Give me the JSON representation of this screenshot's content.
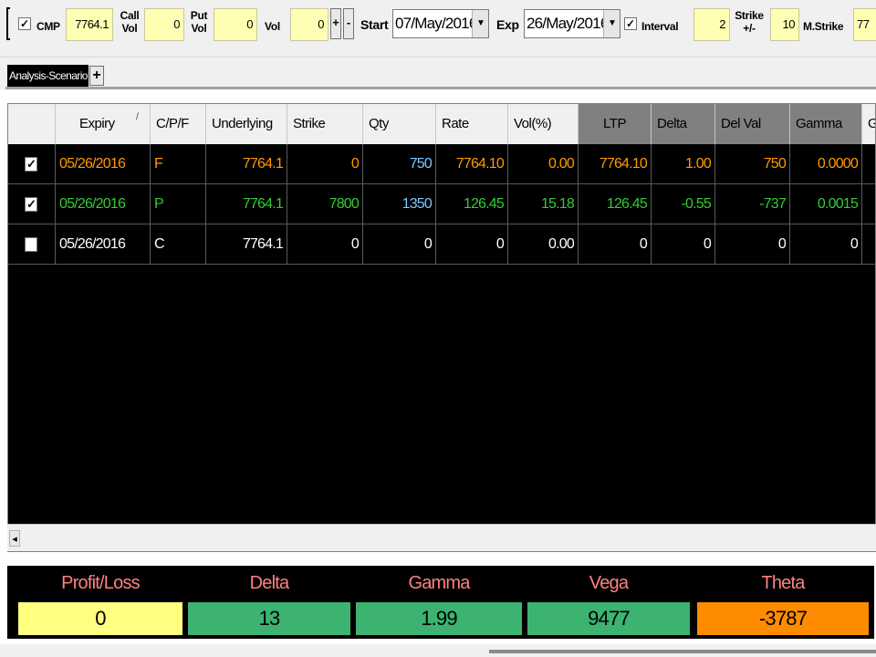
{
  "toolbar": {
    "cmp_checked": true,
    "cmp_label": "CMP",
    "cmp_value": "7764.1",
    "call_vol_label": "Call\nVol",
    "call_vol_value": "0",
    "put_vol_label": "Put\nVol",
    "put_vol_value": "0",
    "vol_label": "Vol",
    "vol_value": "0",
    "plus_label": "+",
    "minus_label": "-",
    "start_label": "Start",
    "start_value": "07/May/2016",
    "exp_label": "Exp",
    "exp_value": "26/May/2016",
    "interval_checked": true,
    "interval_label": "Interval",
    "interval_value": "2",
    "strike_pm_label": "Strike\n+/-",
    "strike_pm_value": "10",
    "mstrike_label": "M.Strike",
    "mstrike_value": "77"
  },
  "tabs": {
    "active": "Analysis-Scenario",
    "add_label": "+"
  },
  "grid": {
    "headers": [
      "",
      "Expiry",
      "C/P/F",
      "Underlying",
      "Strike",
      "Qty",
      "Rate",
      "Vol(%)",
      "LTP",
      "Delta",
      "Del Val",
      "Gamma",
      "G"
    ],
    "sort_marker": "/",
    "rows": [
      {
        "checked": true,
        "color": "#ff9900",
        "cells": [
          "05/26/2016",
          "F",
          "7764.1",
          "0",
          "750",
          "7764.10",
          "0.00",
          "7764.10",
          "1.00",
          "750",
          "0.0000"
        ],
        "qty_color": "#7ec8ff"
      },
      {
        "checked": true,
        "color": "#33cc33",
        "cells": [
          "05/26/2016",
          "P",
          "7764.1",
          "7800",
          "1350",
          "126.45",
          "15.18",
          "126.45",
          "-0.55",
          "-737",
          "0.0015"
        ],
        "qty_color": "#7ec8ff"
      },
      {
        "checked": false,
        "color": "#ffffff",
        "cells": [
          "05/26/2016",
          "C",
          "7764.1",
          "0",
          "0",
          "0",
          "0.00",
          "0",
          "0",
          "0",
          "0"
        ],
        "qty_color": "#ffffff"
      }
    ]
  },
  "scrollbar": {
    "left_arrow": "◂"
  },
  "summary": {
    "headers": [
      "Profit/Loss",
      "Delta",
      "Gamma",
      "Vega",
      "Theta"
    ],
    "values": [
      "0",
      "13",
      "1.99",
      "9477",
      "-3787"
    ],
    "colors": [
      "#ffff80",
      "#3cb371",
      "#3cb371",
      "#3cb371",
      "#ff8c00"
    ],
    "header_color": "#ff8080"
  }
}
